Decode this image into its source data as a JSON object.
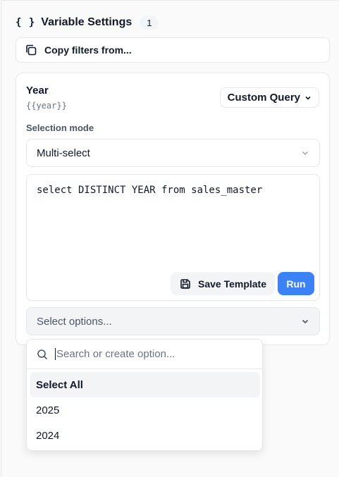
{
  "header": {
    "icon": "braces-icon",
    "title": "Variable Settings",
    "count": "1"
  },
  "copy_filters": {
    "icon": "copy-icon",
    "label": "Copy filters from..."
  },
  "variable": {
    "name": "Year",
    "token": "{{year}}",
    "query_type": "Custom Query",
    "selection_mode_label": "Selection mode",
    "selection_mode_value": "Multi-select",
    "sql": "select DISTINCT YEAR from sales_master",
    "save_template_label": "Save Template",
    "run_label": "Run",
    "options_placeholder": "Select options..."
  },
  "dropdown": {
    "search_placeholder": "Search or create option...",
    "select_all": "Select All",
    "options": [
      "2025",
      "2024"
    ]
  },
  "colors": {
    "accent": "#3b82f6",
    "border": "#e5e7eb",
    "muted_bg": "#f3f4f6"
  }
}
